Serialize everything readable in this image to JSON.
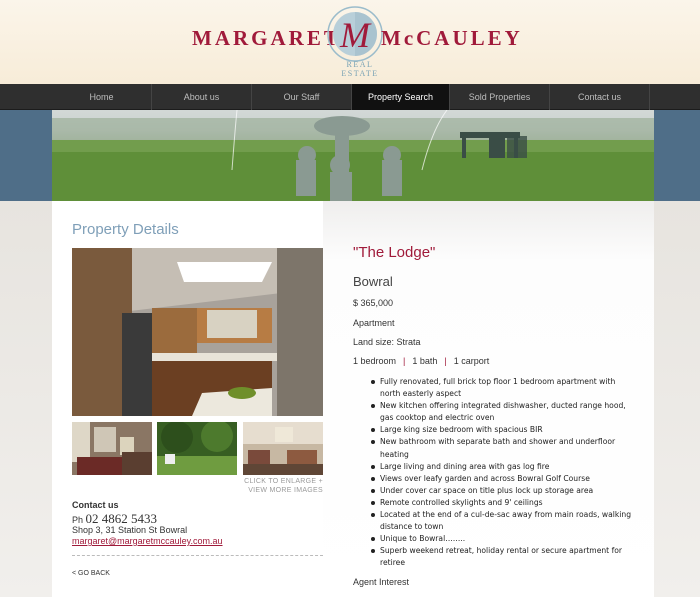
{
  "brand": {
    "name_left": "MARGARET",
    "monogram": "M",
    "name_right": "McCAULEY",
    "tagline": "REAL ESTATE",
    "colors": {
      "primary": "#a01a3a",
      "accent": "#7aa3b5"
    }
  },
  "nav": {
    "items": [
      {
        "label": "Home"
      },
      {
        "label": "About us"
      },
      {
        "label": "Our Staff"
      },
      {
        "label": "Property Search",
        "active": true
      },
      {
        "label": "Sold Properties"
      },
      {
        "label": "Contact us"
      }
    ]
  },
  "left": {
    "section_title": "Property Details",
    "enlarge_line1": "CLICK TO ENLARGE +",
    "enlarge_line2": "VIEW MORE IMAGES",
    "contact": {
      "heading": "Contact us",
      "phone_prefix": "Ph",
      "phone": "02 4862 5433",
      "address": "Shop 3, 31 Station St Bowral",
      "email": "margaret@margaretmccauley.com.au"
    },
    "back_link": "< GO BACK"
  },
  "property": {
    "title": "\"The Lodge\"",
    "suburb": "Bowral",
    "price": "$ 365,000",
    "type": "Apartment",
    "land_size": "Land size: Strata",
    "bedrooms": "1 bedroom",
    "bathrooms": "1 bath",
    "carports": "1 carport",
    "features": [
      "Fully renovated, full brick top floor 1 bedroom apartment with north easterly aspect",
      "New kitchen offering integrated dishwasher, ducted range hood, gas cooktop and electric oven",
      "Large king size bedroom with spacious BIR",
      "New bathroom with separate bath and shower and underfloor heating",
      "Large living and dining area with gas log fire",
      "Views over leafy garden and across Bowral Golf Course",
      "Under cover car space on title plus lock up storage area",
      "Remote controlled skylights and 9' ceilings",
      "Located at the end of a cul-de-sac away from main roads, walking distance to town",
      "Unique to Bowral……..",
      "Superb weekend retreat, holiday rental or secure apartment for retiree"
    ],
    "agent_label": "Agent Interest"
  }
}
